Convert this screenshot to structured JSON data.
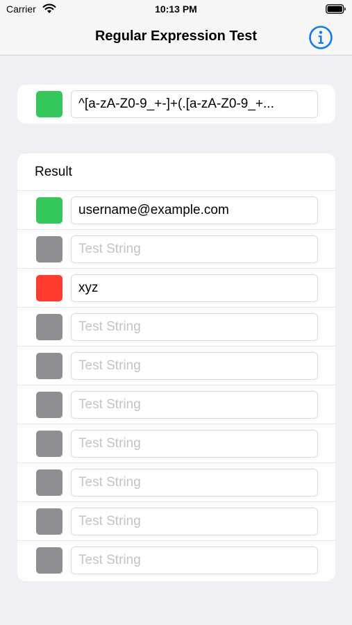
{
  "status_bar": {
    "carrier": "Carrier",
    "time": "10:13 PM"
  },
  "nav": {
    "title": "Regular Expression Test",
    "info_icon": "info-circle-icon"
  },
  "regex": {
    "value": "^[a-zA-Z0-9_+-]+(.[a-zA-Z0-9_+...",
    "status_color": "#34c759"
  },
  "results": {
    "header": "Result",
    "rows": [
      {
        "value": "username@example.com",
        "placeholder": "Test String",
        "color": "#34c759"
      },
      {
        "value": "",
        "placeholder": "Test String",
        "color": "#8e8e93"
      },
      {
        "value": "xyz",
        "placeholder": "Test String",
        "color": "#ff3b30"
      },
      {
        "value": "",
        "placeholder": "Test String",
        "color": "#8e8e93"
      },
      {
        "value": "",
        "placeholder": "Test String",
        "color": "#8e8e93"
      },
      {
        "value": "",
        "placeholder": "Test String",
        "color": "#8e8e93"
      },
      {
        "value": "",
        "placeholder": "Test String",
        "color": "#8e8e93"
      },
      {
        "value": "",
        "placeholder": "Test String",
        "color": "#8e8e93"
      },
      {
        "value": "",
        "placeholder": "Test String",
        "color": "#8e8e93"
      },
      {
        "value": "",
        "placeholder": "Test String",
        "color": "#8e8e93"
      }
    ]
  },
  "colors": {
    "match": "#34c759",
    "no_match": "#ff3b30",
    "empty": "#8e8e93",
    "accent": "#0a7bff"
  }
}
